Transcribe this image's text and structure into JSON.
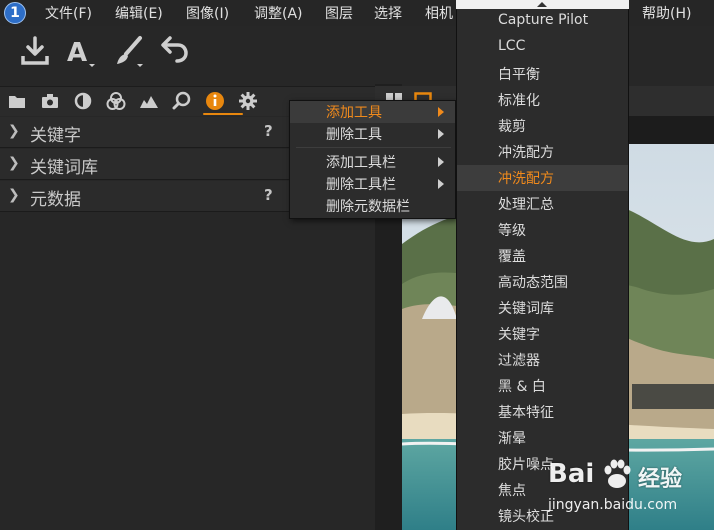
{
  "menubar": {
    "items": [
      "文件(F)",
      "编辑(E)",
      "图像(I)",
      "调整(A)",
      "图层",
      "选择",
      "相机",
      "帮助(H)"
    ],
    "logo_text": "1"
  },
  "toolbar": {
    "icons": [
      "import-icon",
      "text-icon",
      "brush-icon",
      "undo-icon"
    ]
  },
  "tool_tabs": {
    "icons": [
      "folder-icon",
      "camera-icon",
      "color-icon",
      "color-channels-icon",
      "exposure-icon",
      "details-icon",
      "info-icon",
      "settings-icon"
    ],
    "active_index": 6,
    "accent": "#e8870e"
  },
  "panels": [
    {
      "title": "关键字",
      "help": "?"
    },
    {
      "title": "关键词库",
      "help": ""
    },
    {
      "title": "元数据",
      "help": "?"
    }
  ],
  "context_menu": {
    "items": [
      {
        "label": "添加工具",
        "submenu": true,
        "highlighted": true
      },
      {
        "label": "删除工具",
        "submenu": true,
        "highlighted": false
      },
      {
        "label": "添加工具栏",
        "submenu": true,
        "highlighted": false
      },
      {
        "label": "删除工具栏",
        "submenu": true,
        "highlighted": false
      },
      {
        "label": "删除元数据栏",
        "submenu": false,
        "highlighted": false
      }
    ]
  },
  "submenu": {
    "items": [
      "Capture Pilot",
      "LCC",
      "白平衡",
      "标准化",
      "裁剪",
      "冲洗配方",
      "冲洗配方",
      "处理汇总",
      "等级",
      "覆盖",
      "高动态范围",
      "关键词库",
      "关键字",
      "过滤器",
      "黑 & 白",
      "基本特征",
      "渐晕",
      "胶片噪点",
      "焦点",
      "镜头校正"
    ],
    "highlighted_index": 6,
    "highlight_color": "#f08a1c"
  },
  "watermark": {
    "brand": "Bai",
    "brand2": "经验",
    "url": "jingyan.baidu.com"
  }
}
